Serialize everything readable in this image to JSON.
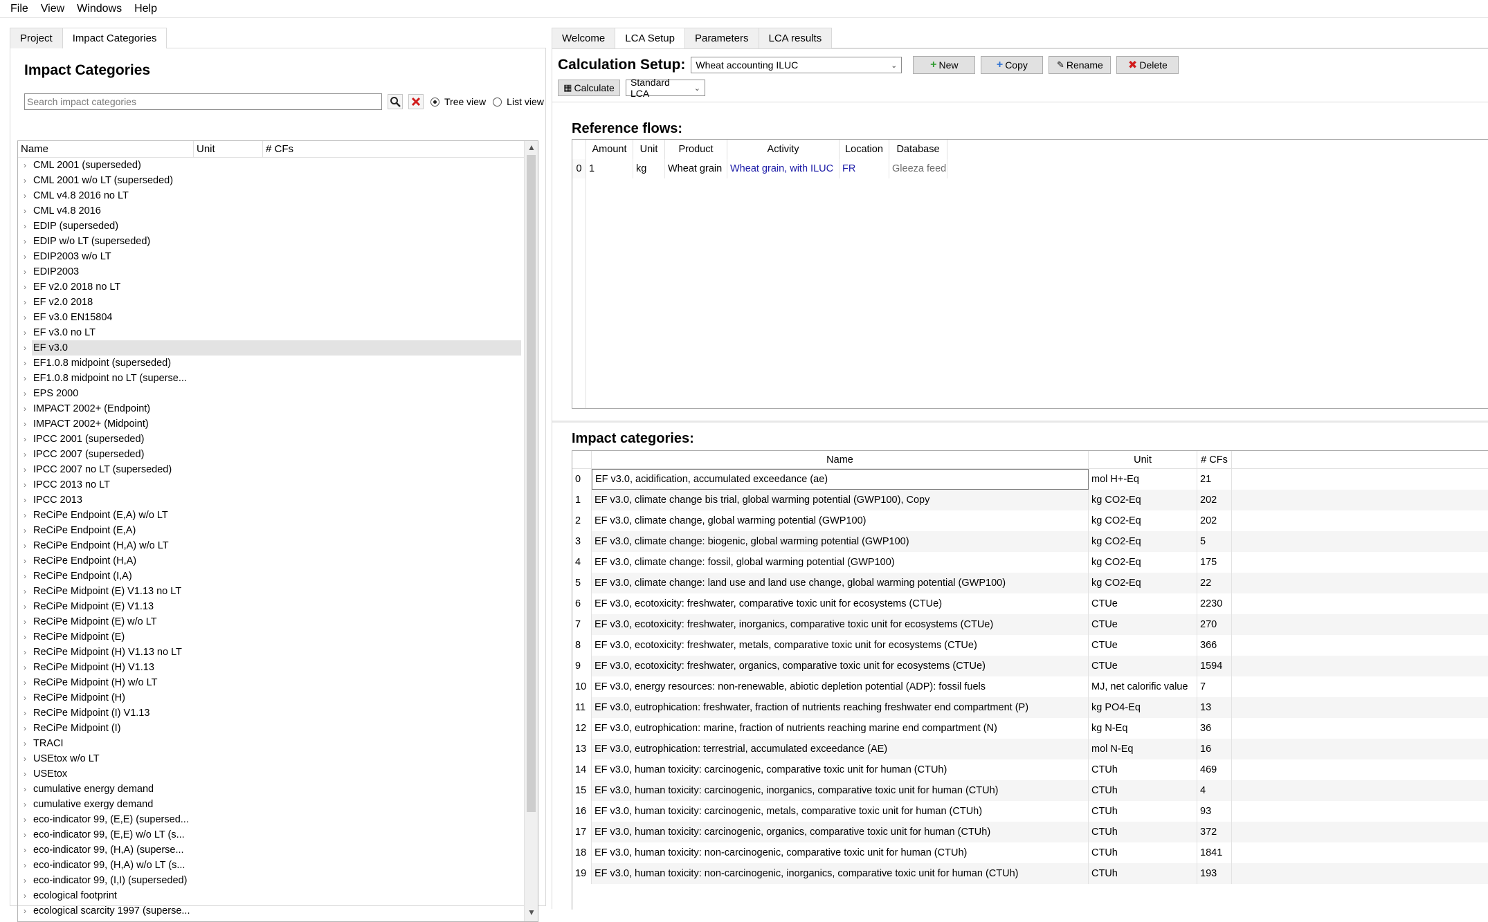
{
  "menubar": {
    "items": [
      "File",
      "View",
      "Windows",
      "Help"
    ]
  },
  "left": {
    "tabs": [
      "Project",
      "Impact Categories"
    ],
    "active_tab": "Impact Categories",
    "title": "Impact Categories",
    "search_placeholder": "Search impact categories",
    "radio_tree": "Tree view",
    "radio_list": "List view",
    "columns": [
      "Name",
      "Unit",
      "# CFs"
    ],
    "selected_item": "EF v3.0",
    "items": [
      "CML 2001 (superseded)",
      "CML 2001 w/o LT (superseded)",
      "CML v4.8 2016 no LT",
      "CML v4.8 2016",
      "EDIP (superseded)",
      "EDIP w/o LT (superseded)",
      "EDIP2003 w/o LT",
      "EDIP2003",
      "EF v2.0 2018 no LT",
      "EF v2.0 2018",
      "EF v3.0 EN15804",
      "EF v3.0 no LT",
      "EF v3.0",
      "EF1.0.8 midpoint (superseded)",
      "EF1.0.8 midpoint no LT (superse...",
      "EPS 2000",
      "IMPACT 2002+ (Endpoint)",
      "IMPACT 2002+ (Midpoint)",
      "IPCC 2001 (superseded)",
      "IPCC 2007 (superseded)",
      "IPCC 2007 no LT (superseded)",
      "IPCC 2013 no LT",
      "IPCC 2013",
      "ReCiPe Endpoint (E,A) w/o LT",
      "ReCiPe Endpoint (E,A)",
      "ReCiPe Endpoint (H,A) w/o LT",
      "ReCiPe Endpoint (H,A)",
      "ReCiPe Endpoint (I,A)",
      "ReCiPe Midpoint (E) V1.13 no LT",
      "ReCiPe Midpoint (E) V1.13",
      "ReCiPe Midpoint (E) w/o LT",
      "ReCiPe Midpoint (E)",
      "ReCiPe Midpoint (H) V1.13 no LT",
      "ReCiPe Midpoint (H) V1.13",
      "ReCiPe Midpoint (H) w/o LT",
      "ReCiPe Midpoint (H)",
      "ReCiPe Midpoint (I) V1.13",
      "ReCiPe Midpoint (I)",
      "TRACI",
      "USEtox w/o LT",
      "USEtox",
      "cumulative energy demand",
      "cumulative exergy demand",
      "eco-indicator 99, (E,E) (supersed...",
      "eco-indicator 99, (E,E) w/o LT (s...",
      "eco-indicator 99, (H,A) (superse...",
      "eco-indicator 99, (H,A) w/o LT (s...",
      "eco-indicator 99, (I,I) (superseded)",
      "ecological footprint",
      "ecological scarcity 1997 (superse..."
    ]
  },
  "right": {
    "tabs": [
      "Welcome",
      "LCA Setup",
      "Parameters",
      "LCA results"
    ],
    "active_tab": "LCA Setup",
    "setup_title": "Calculation Setup:",
    "setup_value": "Wheat accounting ILUC",
    "buttons": {
      "new": "New",
      "copy": "Copy",
      "rename": "Rename",
      "delete": "Delete",
      "calculate": "Calculate"
    },
    "calc_type": "Standard LCA",
    "ref_title": "Reference flows:",
    "ref_columns": [
      "Amount",
      "Unit",
      "Product",
      "Activity",
      "Location",
      "Database"
    ],
    "ref_rows": [
      {
        "index": "0",
        "amount": "1",
        "unit": "kg",
        "product": "Wheat grain",
        "activity": "Wheat grain, with ILUC",
        "location": "FR",
        "database": "Gleeza feed"
      }
    ],
    "imp_title": "Impact categories:",
    "imp_columns": [
      "Name",
      "Unit",
      "# CFs"
    ],
    "imp_rows": [
      {
        "i": "0",
        "name": "EF v3.0, acidification, accumulated exceedance (ae)",
        "unit": "mol H+-Eq",
        "cfs": "21"
      },
      {
        "i": "1",
        "name": "EF v3.0, climate change bis trial, global warming potential (GWP100), Copy",
        "unit": "kg CO2-Eq",
        "cfs": "202"
      },
      {
        "i": "2",
        "name": "EF v3.0, climate change, global warming potential (GWP100)",
        "unit": "kg CO2-Eq",
        "cfs": "202"
      },
      {
        "i": "3",
        "name": "EF v3.0, climate change: biogenic, global warming potential (GWP100)",
        "unit": "kg CO2-Eq",
        "cfs": "5"
      },
      {
        "i": "4",
        "name": "EF v3.0, climate change: fossil, global warming potential (GWP100)",
        "unit": "kg CO2-Eq",
        "cfs": "175"
      },
      {
        "i": "5",
        "name": "EF v3.0, climate change: land use and land use change, global warming potential (GWP100)",
        "unit": "kg CO2-Eq",
        "cfs": "22"
      },
      {
        "i": "6",
        "name": "EF v3.0, ecotoxicity: freshwater, comparative toxic unit for ecosystems (CTUe)",
        "unit": "CTUe",
        "cfs": "2230"
      },
      {
        "i": "7",
        "name": "EF v3.0, ecotoxicity: freshwater, inorganics, comparative toxic unit for ecosystems (CTUe)",
        "unit": "CTUe",
        "cfs": "270"
      },
      {
        "i": "8",
        "name": "EF v3.0, ecotoxicity: freshwater, metals, comparative toxic unit for ecosystems (CTUe)",
        "unit": "CTUe",
        "cfs": "366"
      },
      {
        "i": "9",
        "name": "EF v3.0, ecotoxicity: freshwater, organics, comparative toxic unit for ecosystems (CTUe)",
        "unit": "CTUe",
        "cfs": "1594"
      },
      {
        "i": "10",
        "name": "EF v3.0, energy resources: non-renewable, abiotic depletion potential (ADP): fossil fuels",
        "unit": "MJ, net calorific value",
        "cfs": "7"
      },
      {
        "i": "11",
        "name": "EF v3.0, eutrophication: freshwater, fraction of nutrients reaching freshwater end compartment (P)",
        "unit": "kg PO4-Eq",
        "cfs": "13"
      },
      {
        "i": "12",
        "name": "EF v3.0, eutrophication: marine, fraction of nutrients reaching marine end compartment (N)",
        "unit": "kg N-Eq",
        "cfs": "36"
      },
      {
        "i": "13",
        "name": "EF v3.0, eutrophication: terrestrial, accumulated exceedance (AE)",
        "unit": "mol N-Eq",
        "cfs": "16"
      },
      {
        "i": "14",
        "name": "EF v3.0, human toxicity: carcinogenic, comparative toxic unit for human (CTUh)",
        "unit": "CTUh",
        "cfs": "469"
      },
      {
        "i": "15",
        "name": "EF v3.0, human toxicity: carcinogenic, inorganics, comparative toxic unit for human (CTUh)",
        "unit": "CTUh",
        "cfs": "4"
      },
      {
        "i": "16",
        "name": "EF v3.0, human toxicity: carcinogenic, metals, comparative toxic unit for human (CTUh)",
        "unit": "CTUh",
        "cfs": "93"
      },
      {
        "i": "17",
        "name": "EF v3.0, human toxicity: carcinogenic, organics, comparative toxic unit for human (CTUh)",
        "unit": "CTUh",
        "cfs": "372"
      },
      {
        "i": "18",
        "name": "EF v3.0, human toxicity: non-carcinogenic, comparative toxic unit for human (CTUh)",
        "unit": "CTUh",
        "cfs": "1841"
      },
      {
        "i": "19",
        "name": "EF v3.0, human toxicity: non-carcinogenic, inorganics, comparative toxic unit for human (CTUh)",
        "unit": "CTUh",
        "cfs": "193"
      }
    ]
  },
  "colors": {
    "accent_line": "#5fbfb0",
    "selection": "#e3e3e3",
    "link": "#1a1aa6",
    "new_icon": "#2e9b2e",
    "copy_icon": "#2b6fd1",
    "delete_icon": "#d11c1c"
  }
}
